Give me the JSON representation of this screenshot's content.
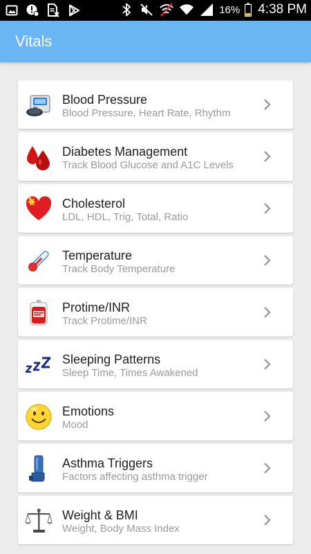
{
  "status_bar": {
    "battery": "16%",
    "time": "4:38 PM",
    "icons": [
      "gallery-icon",
      "alert-location-icon",
      "file-cancel-icon",
      "play-store-icon",
      "bluetooth-icon",
      "mute-icon",
      "no-data-icon",
      "wifi-icon",
      "signal-icon",
      "battery-icon"
    ]
  },
  "app_bar": {
    "title": "Vitals"
  },
  "items": [
    {
      "title": "Blood Pressure",
      "subtitle": "Blood Pressure, Heart Rate, Rhythm",
      "icon": "blood-pressure-monitor-icon"
    },
    {
      "title": "Diabetes Management",
      "subtitle": "Track Blood Glucose and A1C Levels",
      "icon": "blood-drops-icon"
    },
    {
      "title": "Cholesterol",
      "subtitle": "LDL, HDL, Trig, Total, Ratio",
      "icon": "heart-icon"
    },
    {
      "title": "Temperature",
      "subtitle": "Track Body Temperature",
      "icon": "thermometer-icon"
    },
    {
      "title": "Protime/INR",
      "subtitle": "Track Protime/INR",
      "icon": "blood-bag-icon"
    },
    {
      "title": "Sleeping Patterns",
      "subtitle": "Sleep Time, Times Awakened",
      "icon": "zzz-icon"
    },
    {
      "title": "Emotions",
      "subtitle": "Mood",
      "icon": "smiley-icon"
    },
    {
      "title": "Asthma Triggers",
      "subtitle": "Factors affecting asthma trigger",
      "icon": "inhaler-icon"
    },
    {
      "title": "Weight & BMI",
      "subtitle": "Weight, Body Mass Index",
      "icon": "scale-icon"
    }
  ],
  "colors": {
    "app_bar": "#6ab6f5",
    "background": "#ececec",
    "chevron": "#9a9a9a"
  }
}
